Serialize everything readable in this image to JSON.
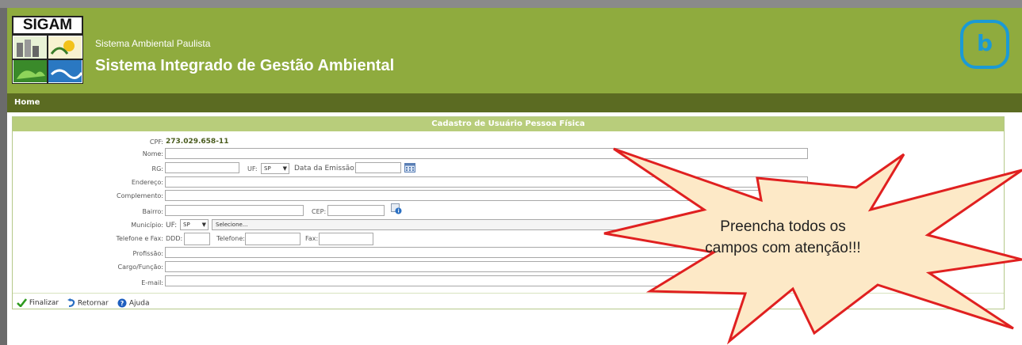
{
  "header": {
    "logo_text": "SIGAM",
    "subtitle": "Sistema Ambiental Paulista",
    "title": "Sistema Integrado de Gestão Ambiental",
    "badge_letter": "b"
  },
  "nav": {
    "home_label": "Home"
  },
  "form": {
    "heading": "Cadastro de Usuário Pessoa Física",
    "cpf_label": "CPF:",
    "cpf_value": "273.029.658-11",
    "nome_label": "Nome:",
    "rg_label": "RG:",
    "uf_label": "UF:",
    "uf_value": "SP",
    "data_emissao_label": "Data da Emissão:",
    "endereco_label": "Endereço:",
    "complemento_label": "Complemento:",
    "bairro_label": "Bairro:",
    "cep_label": "CEP:",
    "municipio_label": "Município:",
    "municipio_uf_label": "UF:",
    "municipio_uf_value": "SP",
    "selecione_label": "Selecione...",
    "telefone_fax_label": "Telefone e Fax:",
    "ddd_label": "DDD:",
    "telefone_label": "Telefone:",
    "fax_label": "Fax:",
    "profissao_label": "Profissão:",
    "cargo_label": "Cargo/Função:",
    "email_label": "E-mail:"
  },
  "actions": {
    "finalizar": "Finalizar",
    "retornar": "Retornar",
    "ajuda": "Ajuda"
  },
  "callout": {
    "line1": "Preencha todos os",
    "line2": "campos com atenção!!!"
  },
  "colors": {
    "header_green": "#8fab3e",
    "nav_dark_green": "#5b6b22",
    "form_header_green": "#b8cd7b",
    "callout_fill": "#fde9c7",
    "callout_stroke": "#e02020",
    "badge_blue": "#1a9ad6"
  }
}
